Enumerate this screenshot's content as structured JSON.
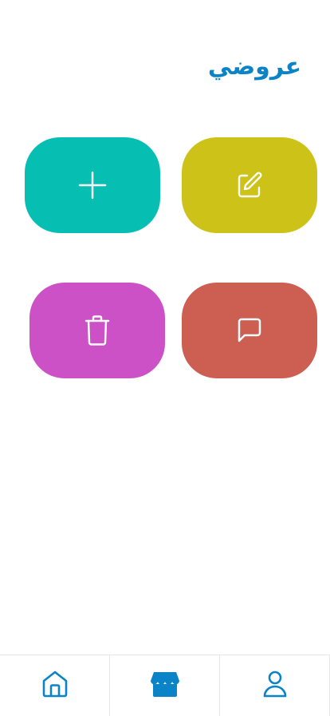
{
  "header": {
    "title": "عروضي"
  },
  "actions": {
    "add": {
      "icon": "plus-icon",
      "color": "#06bfb2"
    },
    "edit": {
      "icon": "edit-icon",
      "color": "#ccc218"
    },
    "delete": {
      "icon": "trash-icon",
      "color": "#cc50c6"
    },
    "message": {
      "icon": "message-icon",
      "color": "#cc5e52"
    }
  },
  "bottom_nav": {
    "items": [
      {
        "icon": "home-icon",
        "active": false
      },
      {
        "icon": "store-icon",
        "active": true
      },
      {
        "icon": "user-icon",
        "active": false
      }
    ],
    "accent_color": "#0a84c6"
  }
}
